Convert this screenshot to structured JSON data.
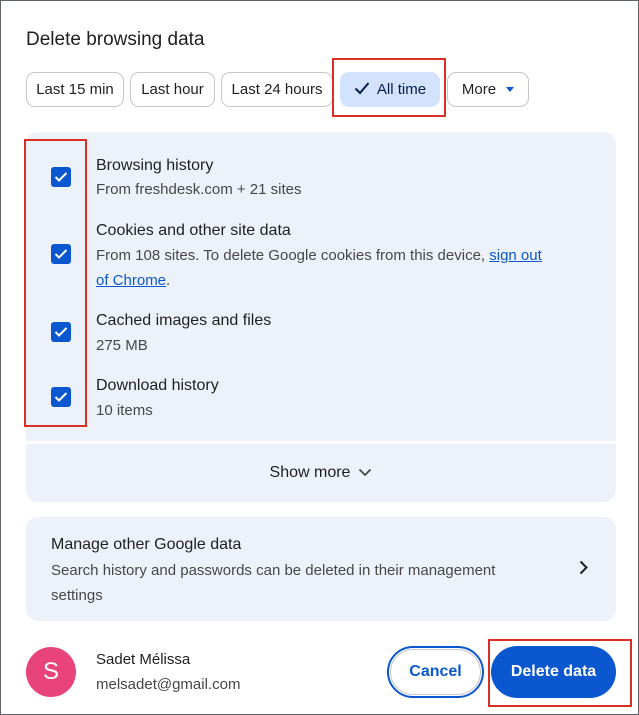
{
  "dialog": {
    "title": "Delete browsing data"
  },
  "time_ranges": {
    "options": [
      "Last 15 min",
      "Last hour",
      "Last 24 hours",
      "All time",
      "More"
    ],
    "selected": "All time"
  },
  "items": [
    {
      "title": "Browsing history",
      "subtitle": "From freshdesk.com + 21 sites",
      "checked": true
    },
    {
      "title": "Cookies and other site data",
      "subtitle_prefix": "From 108 sites. To delete Google cookies from this device,",
      "link_part1": "sign out",
      "link_part2": "of Chrome",
      "subtitle_suffix": ".",
      "checked": true
    },
    {
      "title": "Cached images and files",
      "subtitle": "275 MB",
      "checked": true
    },
    {
      "title": "Download history",
      "subtitle": "10 items",
      "checked": true
    }
  ],
  "show_more": "Show more",
  "manage": {
    "title": "Manage other Google data",
    "line1": "Search history and passwords can be deleted in their management",
    "line2": "settings"
  },
  "account": {
    "initial": "S",
    "name": "Sadet Mélissa",
    "email": "melsadet@gmail.com"
  },
  "buttons": {
    "cancel": "Cancel",
    "delete": "Delete data"
  },
  "colors": {
    "accent": "#0b57d0",
    "selected_chip": "#d3e3fd",
    "card_bg": "#edf2fa",
    "avatar": "#e8437a",
    "highlight_box": "#d93025"
  }
}
